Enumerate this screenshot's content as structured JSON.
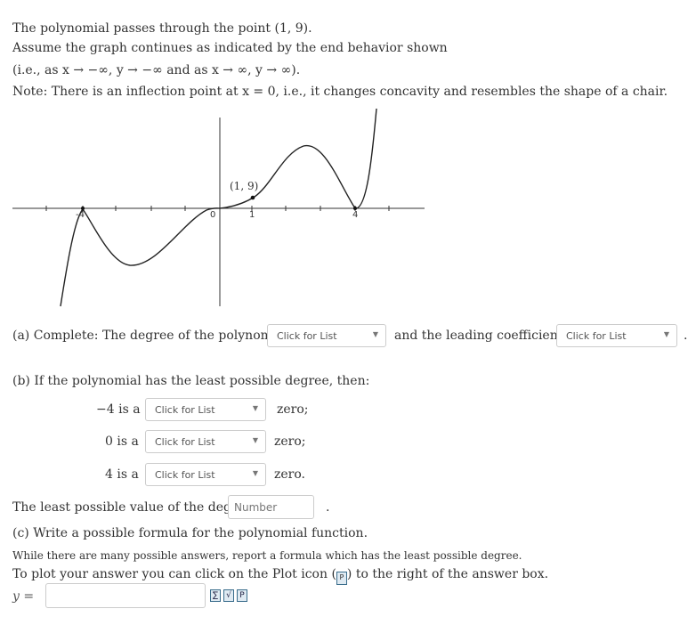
{
  "intro": {
    "line1": "The polynomial passes through the point (1, 9).",
    "line2": "Assume the graph continues as indicated by the end behavior shown",
    "line3": "(i.e., as x → −∞, y → −∞ and as x → ∞, y → ∞).",
    "line4": "Note: There is an inflection point at x = 0, i.e., it changes concavity and resembles the shape of a chair."
  },
  "graph": {
    "point_label": "(1, 9)",
    "tick_neg4": "-4",
    "tick_0": "0",
    "tick_1": "1",
    "tick_4": "4"
  },
  "part_a": {
    "label": "(a)",
    "text1": "Complete:  The degree of the polynomial is",
    "text2": "and the leading coefficient is",
    "degree_select": "Click for List",
    "coef_select": "Click for List",
    "end": "."
  },
  "part_b": {
    "heading": "(b) If the polynomial has the least possible degree, then:",
    "rows": [
      {
        "lhs": "−4  is a",
        "select": "Click for List",
        "rhs": "zero;"
      },
      {
        "lhs": "0  is a",
        "select": "Click for List",
        "rhs": "zero;"
      },
      {
        "lhs": "4  is a",
        "select": "Click for List",
        "rhs": "zero."
      }
    ],
    "least_degree_text": "The least possible value of the degree is",
    "least_degree_placeholder": "Number",
    "least_degree_end": "."
  },
  "part_c": {
    "heading": "(c) Write a possible formula for the polynomial function.",
    "note": "While there are many possible answers, report a formula which has the least possible degree.",
    "plot_text_before": "To plot your answer you can click on the Plot icon (",
    "plot_text_after": ") to the right of the answer box.",
    "y_label": "y ="
  }
}
